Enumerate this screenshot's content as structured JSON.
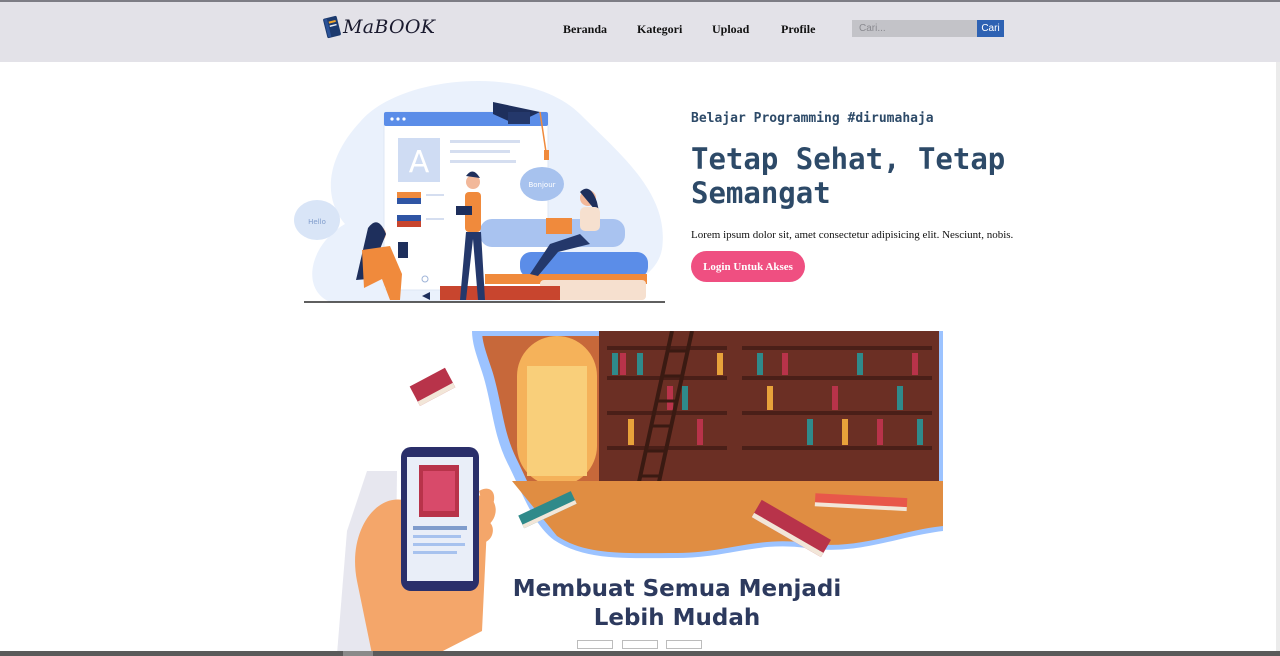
{
  "brand": {
    "name": "MaBOOK"
  },
  "nav": {
    "items": [
      {
        "label": "Beranda"
      },
      {
        "label": "Kategori"
      },
      {
        "label": "Upload"
      },
      {
        "label": "Profile"
      }
    ]
  },
  "search": {
    "placeholder": "Cari...",
    "button_label": "Cari"
  },
  "hero": {
    "subtitle": "Belajar Programming #dirumahaja",
    "title": "Tetap Sehat, Tetap Semangat",
    "description": "Lorem ipsum dolor sit, amet consectetur adipisicing elit. Nesciunt, nobis.",
    "cta_label": "Login Untuk Akses",
    "illustration": {
      "bubble_hello": "Hello",
      "bubble_bonjour": "Bonjour",
      "letter": "A"
    }
  },
  "banner": {
    "caption_line1": "Membuat Semua Menjadi",
    "caption_line2": "Lebih Mudah",
    "slides": 3
  },
  "colors": {
    "navbar_bg": "#e3e2e8",
    "accent_blue": "#2e62b3",
    "cta_pink": "#ef4f81",
    "heading": "#2d4a68"
  }
}
